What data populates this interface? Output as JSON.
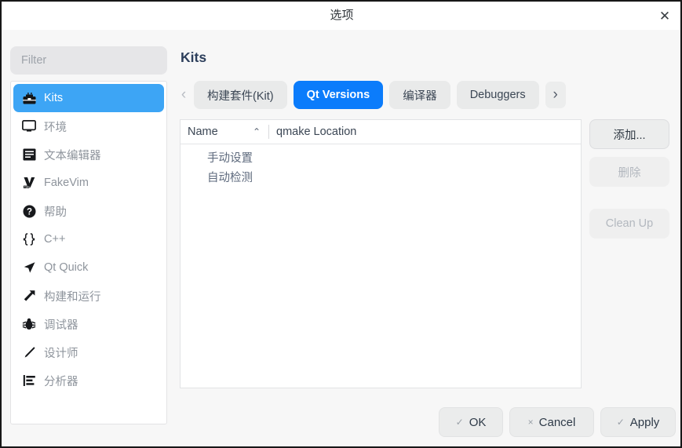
{
  "window": {
    "title": "选项",
    "close_icon": "close-icon"
  },
  "sidebar": {
    "filter": {
      "value": "",
      "placeholder": "Filter"
    },
    "items": [
      {
        "label": "Kits",
        "icon": "kits-icon",
        "selected": true
      },
      {
        "label": "环境",
        "icon": "monitor-icon",
        "selected": false
      },
      {
        "label": "文本编辑器",
        "icon": "text-editor-icon",
        "selected": false
      },
      {
        "label": "FakeVim",
        "icon": "fakevim-icon",
        "selected": false
      },
      {
        "label": "帮助",
        "icon": "help-icon",
        "selected": false
      },
      {
        "label": "C++",
        "icon": "braces-icon",
        "selected": false
      },
      {
        "label": "Qt Quick",
        "icon": "cursor-icon",
        "selected": false
      },
      {
        "label": "构建和运行",
        "icon": "hammer-icon",
        "selected": false
      },
      {
        "label": "调试器",
        "icon": "bug-icon",
        "selected": false
      },
      {
        "label": "设计师",
        "icon": "pencil-icon",
        "selected": false
      },
      {
        "label": "分析器",
        "icon": "analyzer-icon",
        "selected": false
      }
    ]
  },
  "page": {
    "title": "Kits",
    "tabs": {
      "scroll_left_icon": "chevron-left-icon",
      "scroll_right_icon": "chevron-right-icon",
      "items": [
        {
          "label": "构建套件(Kit)",
          "active": false
        },
        {
          "label": "Qt Versions",
          "active": true
        },
        {
          "label": "编译器",
          "active": false
        },
        {
          "label": "Debuggers",
          "active": false
        }
      ]
    },
    "table": {
      "columns": [
        "Name",
        "qmake Location"
      ],
      "sort_column": "Name",
      "sort_indicator": "⌃",
      "rows": [
        {
          "name": "手动设置",
          "location": ""
        },
        {
          "name": "自动检测",
          "location": ""
        }
      ]
    },
    "side_buttons": [
      {
        "label": "添加...",
        "enabled": true
      },
      {
        "label": "删除",
        "enabled": false
      },
      {
        "label": "Clean Up",
        "enabled": false
      }
    ],
    "footer_buttons": [
      {
        "label": "OK",
        "glyph": "✓",
        "icon": "check-icon"
      },
      {
        "label": "Cancel",
        "glyph": "×",
        "icon": "cross-icon"
      },
      {
        "label": "Apply",
        "glyph": "✓",
        "icon": "check-icon"
      }
    ]
  },
  "colors": {
    "tab_active": "#0b7cfb",
    "sidebar_selected": "#3da5f5",
    "title_text": "#2d3f5c",
    "dialog_bg": "#f7f7f7"
  }
}
